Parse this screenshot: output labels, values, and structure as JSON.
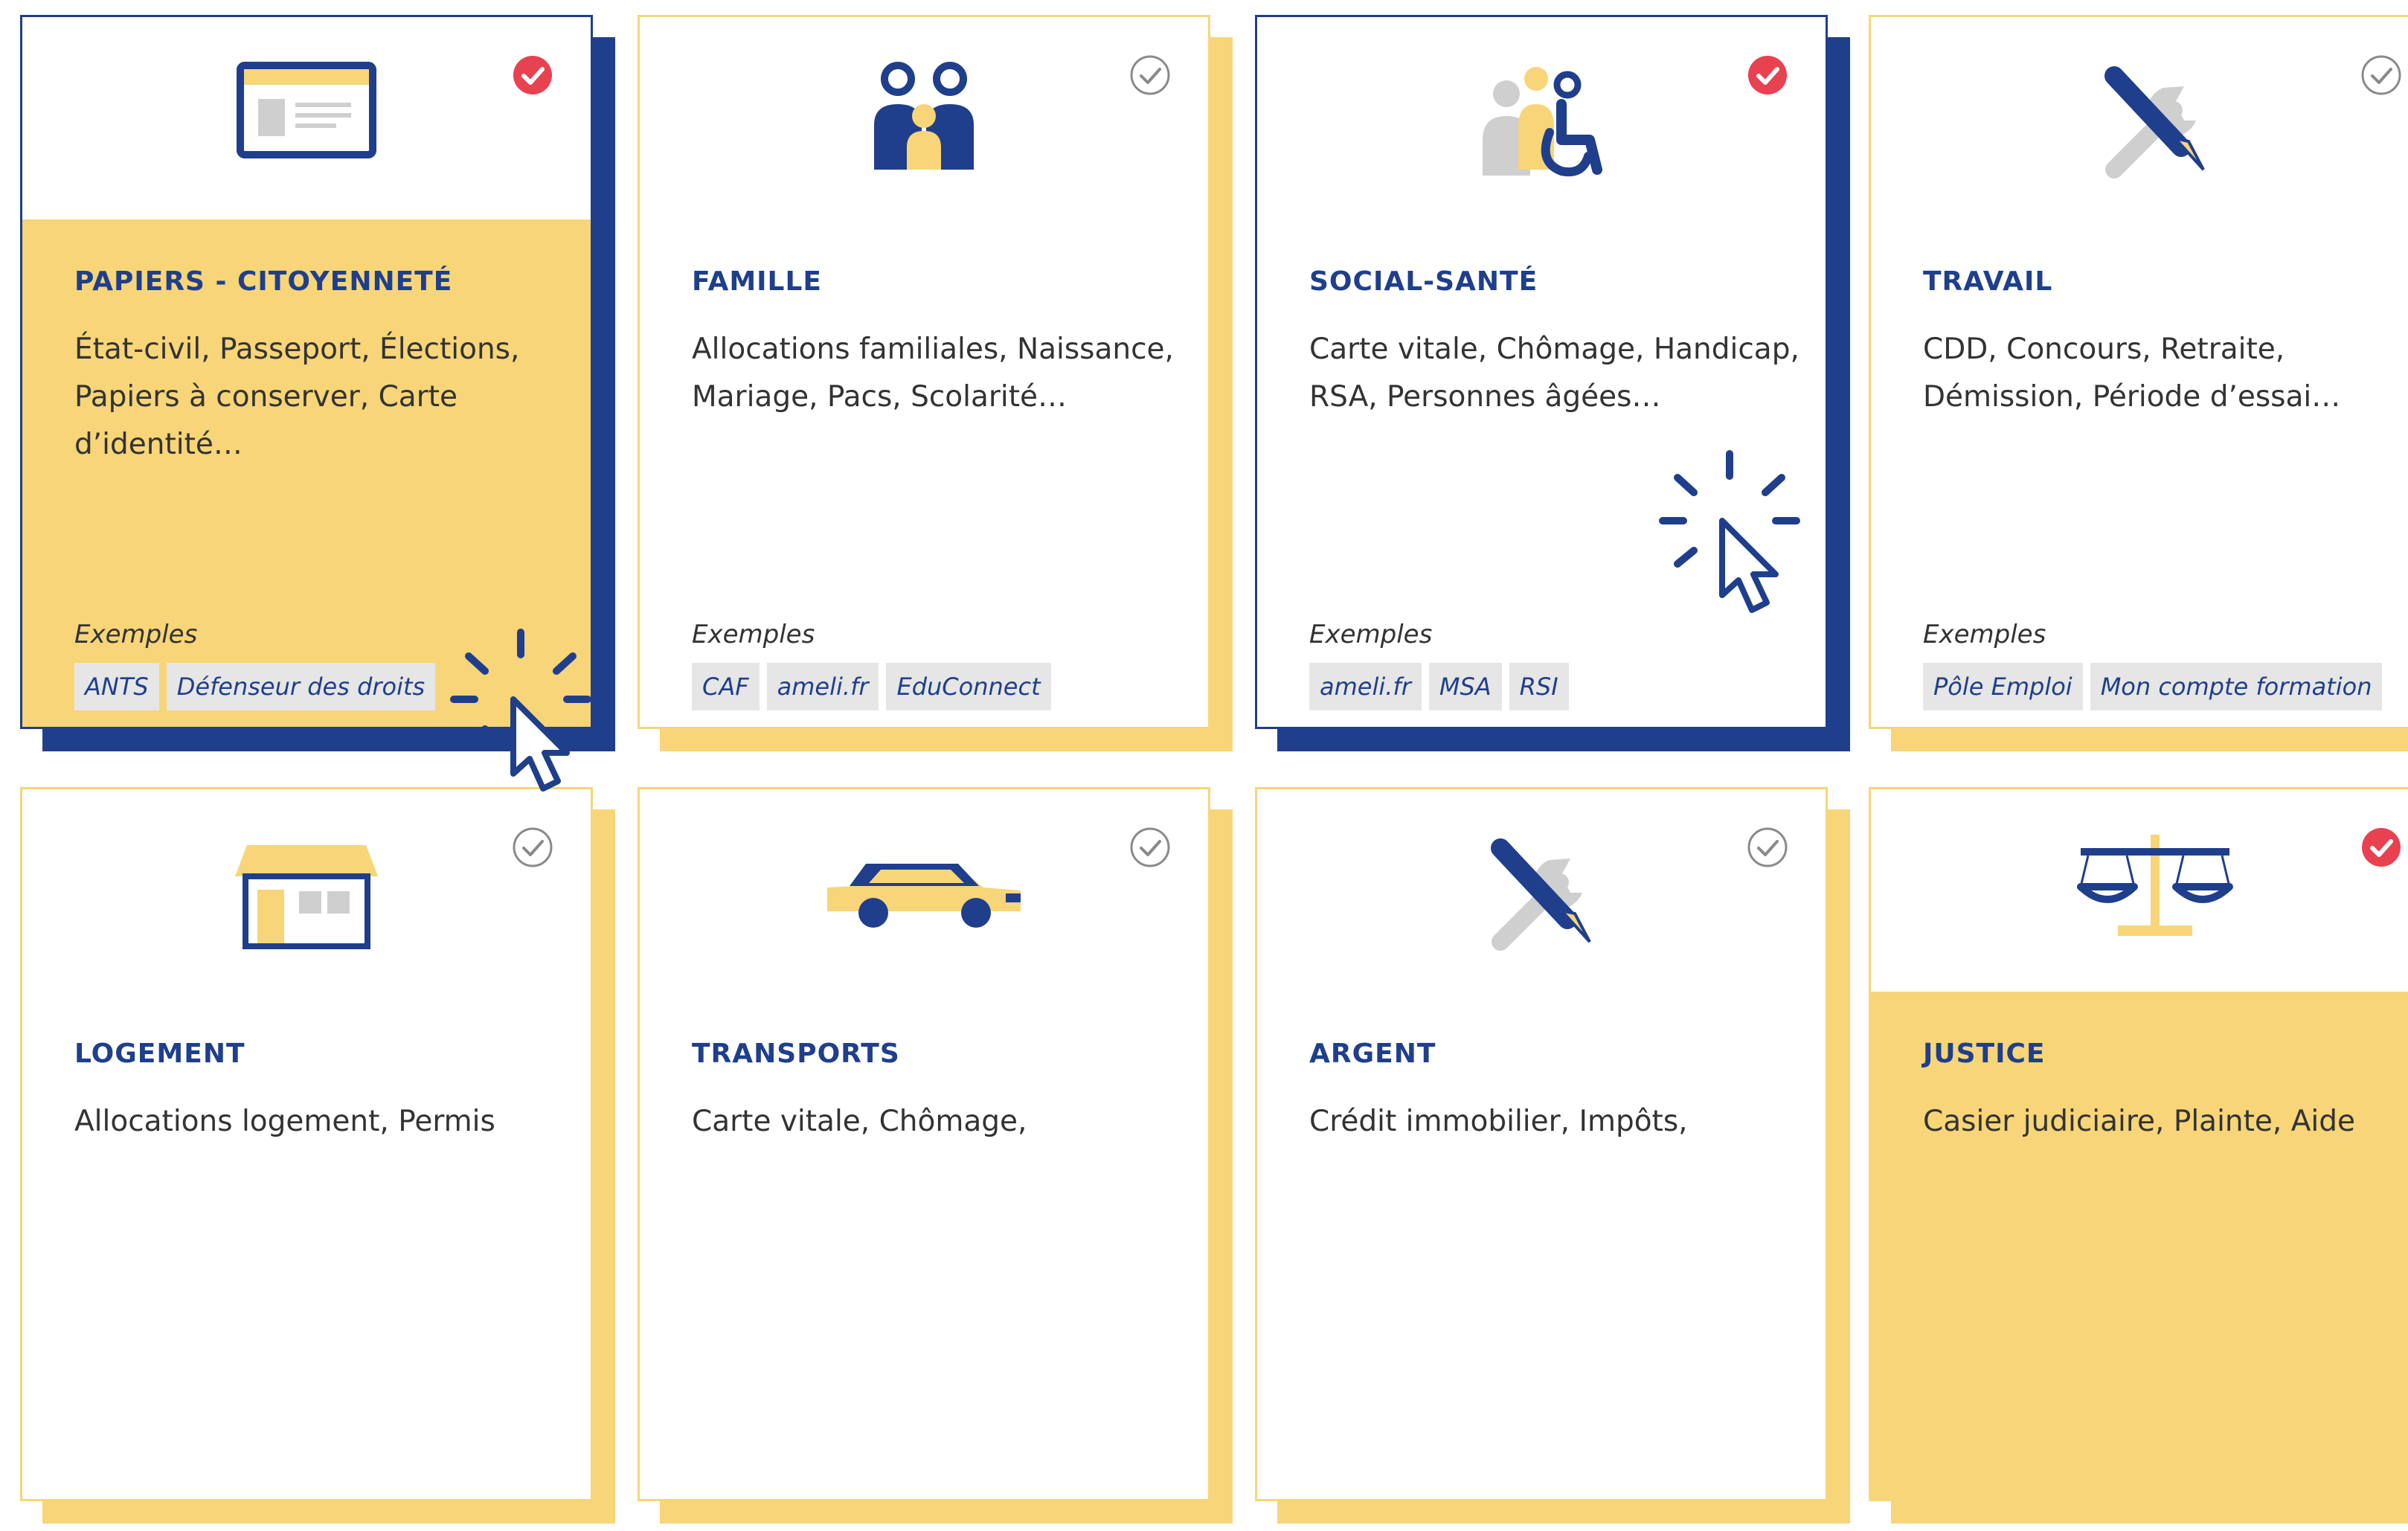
{
  "examples_label": "Exemples",
  "colors": {
    "navy": "#1f3f8c",
    "yellow": "#f7d578",
    "red": "#e84150",
    "tag_bg": "#e6e6e6"
  },
  "cards": [
    {
      "title": "PAPIERS - CITOYENNETÉ",
      "desc": "État-civil, Passeport, Élections, Papiers à conserver, Carte d’identité…",
      "tags": [
        "ANTS",
        "Défenseur des droits"
      ],
      "selected": true,
      "icon": "id-card-icon"
    },
    {
      "title": "FAMILLE",
      "desc": "Allocations familiales, Naissance, Mariage, Pacs, Scolarité…",
      "tags": [
        "CAF",
        "ameli.fr",
        "EduConnect"
      ],
      "selected": false,
      "icon": "family-icon"
    },
    {
      "title": "SOCIAL-SANTÉ",
      "desc": "Carte vitale, Chômage, Handicap, RSA, Personnes âgées…",
      "tags": [
        "ameli.fr",
        "MSA",
        "RSI"
      ],
      "selected": true,
      "icon": "accessibility-icon"
    },
    {
      "title": "TRAVAIL",
      "desc": "CDD, Concours, Retraite, Démission, Période d’essai…",
      "tags": [
        "Pôle Emploi",
        "Mon compte formation"
      ],
      "selected": false,
      "icon": "tools-icon"
    },
    {
      "title": "LOGEMENT",
      "desc": "Allocations logement, Permis",
      "selected": false,
      "icon": "house-icon"
    },
    {
      "title": "TRANSPORTS",
      "desc": "Carte vitale, Chômage,",
      "selected": false,
      "icon": "car-icon"
    },
    {
      "title": "ARGENT",
      "desc": "Crédit immobilier, Impôts,",
      "selected": false,
      "icon": "tools-icon"
    },
    {
      "title": "JUSTICE",
      "desc": "Casier judiciaire, Plainte, Aide",
      "selected": true,
      "icon": "scales-icon"
    }
  ]
}
